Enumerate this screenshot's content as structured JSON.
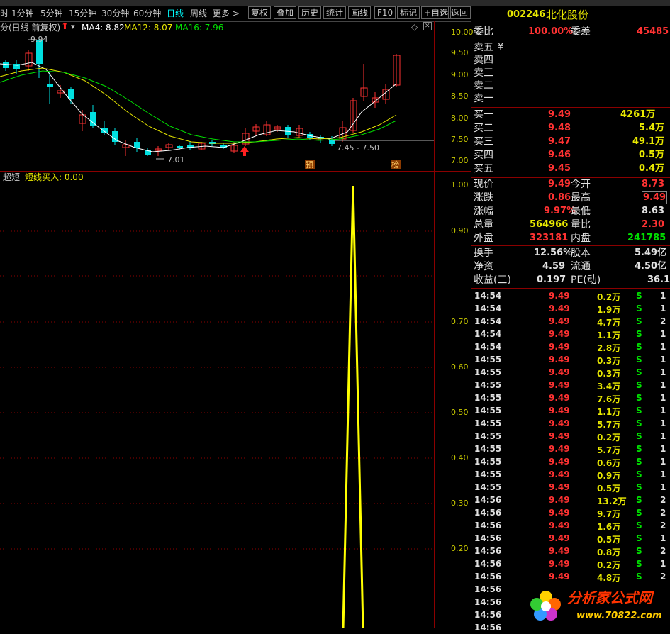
{
  "toolbar": {
    "items": [
      "时",
      "1分钟",
      "5分钟",
      "15分钟",
      "30分钟",
      "60分钟",
      "日线",
      "周线",
      "更多 >",
      "复权",
      "叠加",
      "历史",
      "统计",
      "画线",
      "F10",
      "标记",
      "+自选",
      "返回"
    ],
    "active": "日线"
  },
  "kline": {
    "title": "分(日线 前复权)",
    "ma4": "MA4: 8.82",
    "ma12": "MA12: 8.07",
    "ma16": "MA16: 7.96",
    "high_label": "9.94",
    "low_label": "7.01",
    "range_label": "7.45 - 7.50",
    "mark_yu": "预",
    "mark_bang": "榜",
    "axis": [
      "10.00",
      "9.50",
      "9.00",
      "8.50",
      "8.00",
      "7.50",
      "7.00"
    ]
  },
  "indicator": {
    "name": "超短",
    "output": "短线买入: 0.00",
    "axis": [
      "1.00",
      "0.90",
      "0.70",
      "0.60",
      "0.50",
      "0.40",
      "0.30",
      "0.20"
    ]
  },
  "quote": {
    "code": "002246",
    "name": "北化股份",
    "weibi_label": "委比",
    "weibi": "100.00%",
    "weicha_label": "委差",
    "weicha": "45485",
    "sells": [
      {
        "label": "卖五",
        "price": "¥",
        "vol": ""
      },
      {
        "label": "卖四",
        "price": "",
        "vol": ""
      },
      {
        "label": "卖三",
        "price": "",
        "vol": ""
      },
      {
        "label": "卖二",
        "price": "",
        "vol": ""
      },
      {
        "label": "卖一",
        "price": "",
        "vol": ""
      }
    ],
    "buys": [
      {
        "label": "买一",
        "price": "9.49",
        "vol": "4261万"
      },
      {
        "label": "买二",
        "price": "9.48",
        "vol": "5.4万"
      },
      {
        "label": "买三",
        "price": "9.47",
        "vol": "49.1万"
      },
      {
        "label": "买四",
        "price": "9.46",
        "vol": "0.5万"
      },
      {
        "label": "买五",
        "price": "9.45",
        "vol": "0.4万"
      }
    ],
    "stats": [
      {
        "l1": "现价",
        "v1": "9.49",
        "c1": "red",
        "l2": "今开",
        "v2": "8.73",
        "c2": "red"
      },
      {
        "l1": "涨跌",
        "v1": "0.86",
        "c1": "red",
        "l2": "最高",
        "v2": "9.49",
        "c2": "red"
      },
      {
        "l1": "涨幅",
        "v1": "9.97%",
        "c1": "red",
        "l2": "最低",
        "v2": "8.63",
        "c2": "white"
      },
      {
        "l1": "总量",
        "v1": "564966",
        "c1": "yellow",
        "l2": "量比",
        "v2": "2.30",
        "c2": "red"
      },
      {
        "l1": "外盘",
        "v1": "323181",
        "c1": "red",
        "l2": "内盘",
        "v2": "241785",
        "c2": "green"
      }
    ],
    "stats2": [
      {
        "l1": "换手",
        "v1": "12.56%",
        "l2": "股本",
        "v2": "5.49亿"
      },
      {
        "l1": "净资",
        "v1": "4.59",
        "l2": "流通",
        "v2": "4.50亿"
      },
      {
        "l1": "收益(三)",
        "v1": "0.197",
        "l2": "PE(动)",
        "v2": "36.1"
      }
    ],
    "ticks": [
      {
        "t": "14:54",
        "p": "9.49",
        "v": "0.2万",
        "s": "S",
        "n": "1"
      },
      {
        "t": "14:54",
        "p": "9.49",
        "v": "1.9万",
        "s": "S",
        "n": "1"
      },
      {
        "t": "14:54",
        "p": "9.49",
        "v": "4.7万",
        "s": "S",
        "n": "2"
      },
      {
        "t": "14:54",
        "p": "9.49",
        "v": "1.1万",
        "s": "S",
        "n": "1"
      },
      {
        "t": "14:54",
        "p": "9.49",
        "v": "2.8万",
        "s": "S",
        "n": "1"
      },
      {
        "t": "14:55",
        "p": "9.49",
        "v": "0.3万",
        "s": "S",
        "n": "1"
      },
      {
        "t": "14:55",
        "p": "9.49",
        "v": "0.3万",
        "s": "S",
        "n": "1"
      },
      {
        "t": "14:55",
        "p": "9.49",
        "v": "3.4万",
        "s": "S",
        "n": "1"
      },
      {
        "t": "14:55",
        "p": "9.49",
        "v": "7.6万",
        "s": "S",
        "n": "1"
      },
      {
        "t": "14:55",
        "p": "9.49",
        "v": "1.1万",
        "s": "S",
        "n": "1"
      },
      {
        "t": "14:55",
        "p": "9.49",
        "v": "5.7万",
        "s": "S",
        "n": "1"
      },
      {
        "t": "14:55",
        "p": "9.49",
        "v": "0.2万",
        "s": "S",
        "n": "1"
      },
      {
        "t": "14:55",
        "p": "9.49",
        "v": "5.7万",
        "s": "S",
        "n": "1"
      },
      {
        "t": "14:55",
        "p": "9.49",
        "v": "0.6万",
        "s": "S",
        "n": "1"
      },
      {
        "t": "14:55",
        "p": "9.49",
        "v": "0.9万",
        "s": "S",
        "n": "1"
      },
      {
        "t": "14:55",
        "p": "9.49",
        "v": "0.5万",
        "s": "S",
        "n": "1"
      },
      {
        "t": "14:56",
        "p": "9.49",
        "v": "13.2万",
        "s": "S",
        "n": "2"
      },
      {
        "t": "14:56",
        "p": "9.49",
        "v": "9.7万",
        "s": "S",
        "n": "2"
      },
      {
        "t": "14:56",
        "p": "9.49",
        "v": "1.6万",
        "s": "S",
        "n": "2"
      },
      {
        "t": "14:56",
        "p": "9.49",
        "v": "0.5万",
        "s": "S",
        "n": "1"
      },
      {
        "t": "14:56",
        "p": "9.49",
        "v": "0.8万",
        "s": "S",
        "n": "2"
      },
      {
        "t": "14:56",
        "p": "9.49",
        "v": "0.2万",
        "s": "S",
        "n": "1"
      },
      {
        "t": "14:56",
        "p": "9.49",
        "v": "4.8万",
        "s": "S",
        "n": "2"
      }
    ],
    "tick_tail_times": [
      "14:56",
      "14:56",
      "14:56",
      "14:56"
    ]
  },
  "watermark": {
    "text": "分析家公式网",
    "url": "www.70822.com"
  }
}
